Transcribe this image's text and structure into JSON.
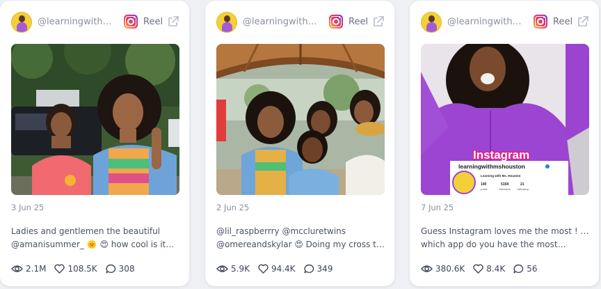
{
  "cards": [
    {
      "username": "@learningwithm…",
      "type_label": "Reel",
      "date": "3 Jun 25",
      "caption_line1": "Ladies and gentlemen the beautiful",
      "caption_line2": "@amanisummer_ 🌞 😍 how cool is it…",
      "views": "2.1M",
      "likes": "108.5K",
      "comments": "308"
    },
    {
      "username": "@learningwithm…",
      "type_label": "Reel",
      "date": "2 Jun 25",
      "caption_line1": "@lil_raspberrry @mccluretwins",
      "caption_line2": "@omereandskylar 😍 Doing my cross th…",
      "views": "5.9K",
      "likes": "94.4K",
      "comments": "349"
    },
    {
      "username": "@learningwithm…",
      "type_label": "Reel",
      "date": "7 Jun 25",
      "caption_line1": "Guess Instagram loves me the most ! Lol",
      "caption_line2": "which app do you have the most…",
      "views": "380.6K",
      "likes": "8.4K",
      "comments": "56",
      "overlay_title": "Instagram",
      "overlay_handle": "learningwithmshouston",
      "overlay_name": "Learning with Ms. Houston",
      "overlay_posts_value": "100",
      "overlay_posts_label": "posts",
      "overlay_followers_value": "515K",
      "overlay_followers_label": "followers",
      "overlay_following_value": "21",
      "overlay_following_label": "following"
    }
  ],
  "icons": {
    "views": "eye-icon",
    "likes": "heart-icon",
    "comments": "comment-icon",
    "platform": "instagram-icon",
    "external": "external-link-icon"
  },
  "colors": {
    "background": "#eef0f4",
    "card": "#ffffff",
    "muted_text": "#8a90a0",
    "body_text": "#4a5264",
    "overlay_pink": "#e0218a"
  }
}
